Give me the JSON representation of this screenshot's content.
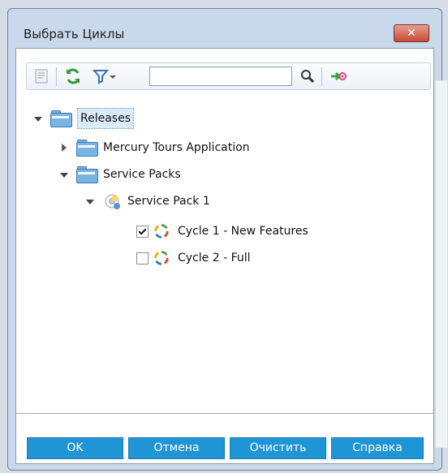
{
  "window": {
    "title": "Выбрать Циклы",
    "close_label": "✕"
  },
  "toolbar": {
    "search_value": "",
    "icons": [
      "properties-icon",
      "refresh-icon",
      "filter-icon",
      "dropdown-icon",
      "search-icon",
      "go-to-icon"
    ]
  },
  "tree": {
    "items": [
      {
        "label": "Releases",
        "expanded": true,
        "type": "folder"
      },
      {
        "label": "Mercury Tours Application",
        "expanded": false,
        "type": "folder"
      },
      {
        "label": "Service Packs",
        "expanded": true,
        "type": "folder"
      },
      {
        "label": "Service Pack 1",
        "expanded": true,
        "type": "release"
      },
      {
        "label": "Cycle 1 - New Features",
        "checked": true,
        "type": "cycle"
      },
      {
        "label": "Cycle 2 - Full",
        "checked": false,
        "type": "cycle"
      }
    ]
  },
  "buttons": {
    "ok": "OK",
    "cancel": "Отмена",
    "clear": "Очистить",
    "help": "Справка"
  },
  "colors": {
    "button": "#1f95d6",
    "window": "#c9d8ea",
    "close": "#c74a34"
  }
}
